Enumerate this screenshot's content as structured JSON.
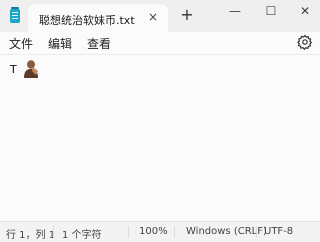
{
  "tab": {
    "title": "聪想统治软妹币.txt",
    "close": "×"
  },
  "new_tab": "+",
  "window_buttons": {
    "minimize": "—",
    "maximize": "☐",
    "close": "✕"
  },
  "menu": [
    "文件",
    "编辑",
    "查看"
  ],
  "editor": {
    "text": "T"
  },
  "status": {
    "position": "行 1，列 1",
    "chars": "1 个字符",
    "zoom": "100%",
    "line_ending": "Windows (CRLF)",
    "encoding": "UTF-8"
  },
  "icons": {
    "app": "notepad-icon",
    "settings": "gear-icon",
    "inline_image": "person-emoji-icon"
  }
}
